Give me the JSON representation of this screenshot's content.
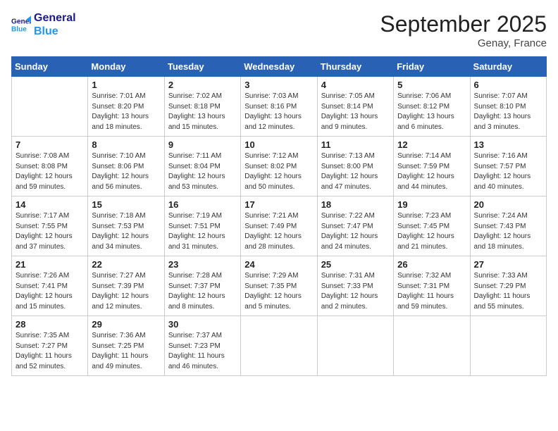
{
  "header": {
    "logo_line1": "General",
    "logo_line2": "Blue",
    "month": "September 2025",
    "location": "Genay, France"
  },
  "days_of_week": [
    "Sunday",
    "Monday",
    "Tuesday",
    "Wednesday",
    "Thursday",
    "Friday",
    "Saturday"
  ],
  "weeks": [
    [
      {
        "day": "",
        "info": ""
      },
      {
        "day": "1",
        "info": "Sunrise: 7:01 AM\nSunset: 8:20 PM\nDaylight: 13 hours\nand 18 minutes."
      },
      {
        "day": "2",
        "info": "Sunrise: 7:02 AM\nSunset: 8:18 PM\nDaylight: 13 hours\nand 15 minutes."
      },
      {
        "day": "3",
        "info": "Sunrise: 7:03 AM\nSunset: 8:16 PM\nDaylight: 13 hours\nand 12 minutes."
      },
      {
        "day": "4",
        "info": "Sunrise: 7:05 AM\nSunset: 8:14 PM\nDaylight: 13 hours\nand 9 minutes."
      },
      {
        "day": "5",
        "info": "Sunrise: 7:06 AM\nSunset: 8:12 PM\nDaylight: 13 hours\nand 6 minutes."
      },
      {
        "day": "6",
        "info": "Sunrise: 7:07 AM\nSunset: 8:10 PM\nDaylight: 13 hours\nand 3 minutes."
      }
    ],
    [
      {
        "day": "7",
        "info": "Sunrise: 7:08 AM\nSunset: 8:08 PM\nDaylight: 12 hours\nand 59 minutes."
      },
      {
        "day": "8",
        "info": "Sunrise: 7:10 AM\nSunset: 8:06 PM\nDaylight: 12 hours\nand 56 minutes."
      },
      {
        "day": "9",
        "info": "Sunrise: 7:11 AM\nSunset: 8:04 PM\nDaylight: 12 hours\nand 53 minutes."
      },
      {
        "day": "10",
        "info": "Sunrise: 7:12 AM\nSunset: 8:02 PM\nDaylight: 12 hours\nand 50 minutes."
      },
      {
        "day": "11",
        "info": "Sunrise: 7:13 AM\nSunset: 8:00 PM\nDaylight: 12 hours\nand 47 minutes."
      },
      {
        "day": "12",
        "info": "Sunrise: 7:14 AM\nSunset: 7:59 PM\nDaylight: 12 hours\nand 44 minutes."
      },
      {
        "day": "13",
        "info": "Sunrise: 7:16 AM\nSunset: 7:57 PM\nDaylight: 12 hours\nand 40 minutes."
      }
    ],
    [
      {
        "day": "14",
        "info": "Sunrise: 7:17 AM\nSunset: 7:55 PM\nDaylight: 12 hours\nand 37 minutes."
      },
      {
        "day": "15",
        "info": "Sunrise: 7:18 AM\nSunset: 7:53 PM\nDaylight: 12 hours\nand 34 minutes."
      },
      {
        "day": "16",
        "info": "Sunrise: 7:19 AM\nSunset: 7:51 PM\nDaylight: 12 hours\nand 31 minutes."
      },
      {
        "day": "17",
        "info": "Sunrise: 7:21 AM\nSunset: 7:49 PM\nDaylight: 12 hours\nand 28 minutes."
      },
      {
        "day": "18",
        "info": "Sunrise: 7:22 AM\nSunset: 7:47 PM\nDaylight: 12 hours\nand 24 minutes."
      },
      {
        "day": "19",
        "info": "Sunrise: 7:23 AM\nSunset: 7:45 PM\nDaylight: 12 hours\nand 21 minutes."
      },
      {
        "day": "20",
        "info": "Sunrise: 7:24 AM\nSunset: 7:43 PM\nDaylight: 12 hours\nand 18 minutes."
      }
    ],
    [
      {
        "day": "21",
        "info": "Sunrise: 7:26 AM\nSunset: 7:41 PM\nDaylight: 12 hours\nand 15 minutes."
      },
      {
        "day": "22",
        "info": "Sunrise: 7:27 AM\nSunset: 7:39 PM\nDaylight: 12 hours\nand 12 minutes."
      },
      {
        "day": "23",
        "info": "Sunrise: 7:28 AM\nSunset: 7:37 PM\nDaylight: 12 hours\nand 8 minutes."
      },
      {
        "day": "24",
        "info": "Sunrise: 7:29 AM\nSunset: 7:35 PM\nDaylight: 12 hours\nand 5 minutes."
      },
      {
        "day": "25",
        "info": "Sunrise: 7:31 AM\nSunset: 7:33 PM\nDaylight: 12 hours\nand 2 minutes."
      },
      {
        "day": "26",
        "info": "Sunrise: 7:32 AM\nSunset: 7:31 PM\nDaylight: 11 hours\nand 59 minutes."
      },
      {
        "day": "27",
        "info": "Sunrise: 7:33 AM\nSunset: 7:29 PM\nDaylight: 11 hours\nand 55 minutes."
      }
    ],
    [
      {
        "day": "28",
        "info": "Sunrise: 7:35 AM\nSunset: 7:27 PM\nDaylight: 11 hours\nand 52 minutes."
      },
      {
        "day": "29",
        "info": "Sunrise: 7:36 AM\nSunset: 7:25 PM\nDaylight: 11 hours\nand 49 minutes."
      },
      {
        "day": "30",
        "info": "Sunrise: 7:37 AM\nSunset: 7:23 PM\nDaylight: 11 hours\nand 46 minutes."
      },
      {
        "day": "",
        "info": ""
      },
      {
        "day": "",
        "info": ""
      },
      {
        "day": "",
        "info": ""
      },
      {
        "day": "",
        "info": ""
      }
    ]
  ]
}
